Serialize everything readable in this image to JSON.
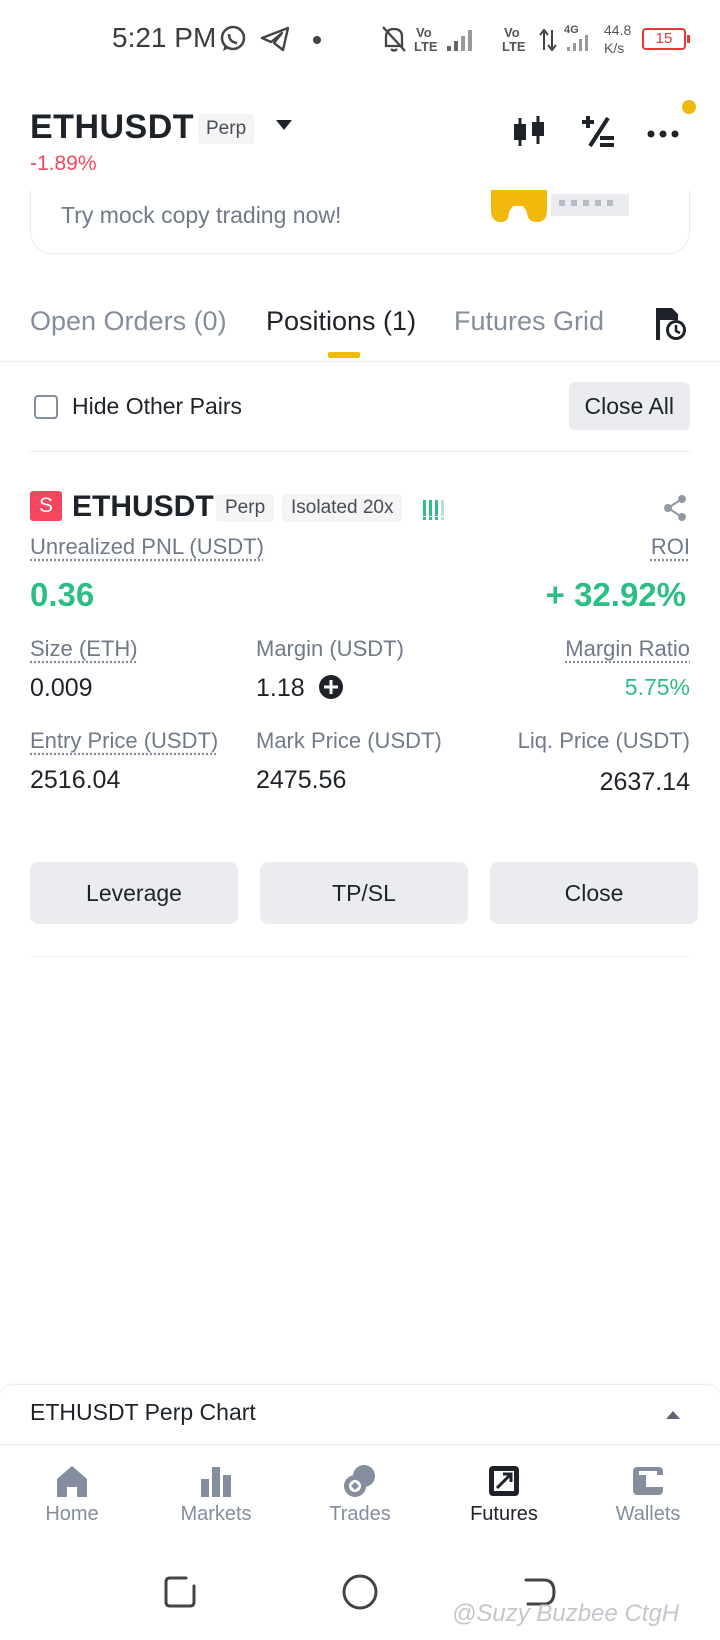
{
  "status_bar": {
    "time": "5:21 PM",
    "volte1_top": "Vo",
    "volte1_bottom": "LTE",
    "volte2_top": "Vo",
    "volte2_bottom": "LTE",
    "net_type": "4G",
    "speed_value": "44.8",
    "speed_unit": "K/s",
    "battery": "15",
    "icons": [
      "whatsapp-icon",
      "telegram-icon",
      "dot-icon",
      "mute-bell-icon",
      "signal-icon",
      "data-arrows-icon",
      "battery-icon"
    ]
  },
  "header": {
    "pair": "ETHUSDT",
    "contract_type": "Perp",
    "change_pct": "-1.89%",
    "icons": [
      "candlestick-icon",
      "calculator-icon",
      "more-icon"
    ]
  },
  "banner": {
    "text": "Try mock copy trading now!"
  },
  "tabs": [
    {
      "label": "Open Orders (0)",
      "active": false
    },
    {
      "label": "Positions (1)",
      "active": true
    },
    {
      "label": "Futures Grid",
      "active": false
    }
  ],
  "filter": {
    "hide_other_pairs_label": "Hide Other Pairs",
    "hide_other_pairs_checked": false,
    "close_all_label": "Close All"
  },
  "position": {
    "side_badge": "S",
    "symbol": "ETHUSDT",
    "contract_type": "Perp",
    "margin_mode": "Isolated 20x",
    "colors": {
      "profit": "#2ebd85",
      "short": "#f6465d",
      "accent": "#f0b90b"
    },
    "unrealized_pnl_label": "Unrealized PNL (USDT)",
    "unrealized_pnl": "0.36",
    "roi_label": "ROI",
    "roi": "+ 32.92%",
    "size_label": "Size (ETH)",
    "size": "0.009",
    "margin_label": "Margin (USDT)",
    "margin": "1.18",
    "margin_ratio_label": "Margin Ratio",
    "margin_ratio": "5.75%",
    "entry_price_label": "Entry Price (USDT)",
    "entry_price": "2516.04",
    "mark_price_label": "Mark Price (USDT)",
    "mark_price": "2475.56",
    "liq_price_label": "Liq. Price (USDT)",
    "liq_price": "2637.14",
    "buttons": {
      "leverage": "Leverage",
      "tpsl": "TP/SL",
      "close": "Close"
    }
  },
  "chart_toggle": {
    "label": "ETHUSDT Perp Chart"
  },
  "bottom_nav": [
    {
      "label": "Home",
      "icon": "home-icon",
      "active": false
    },
    {
      "label": "Markets",
      "icon": "markets-icon",
      "active": false
    },
    {
      "label": "Trades",
      "icon": "trades-icon",
      "active": false
    },
    {
      "label": "Futures",
      "icon": "futures-icon",
      "active": true
    },
    {
      "label": "Wallets",
      "icon": "wallet-icon",
      "active": false
    }
  ],
  "watermark": "@Suzy Buzbee CtgH"
}
